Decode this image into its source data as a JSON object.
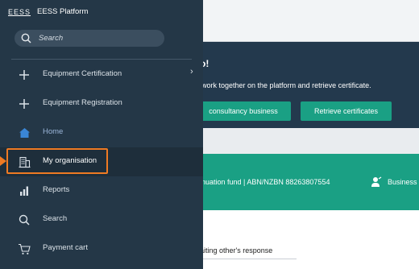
{
  "brand": {
    "logo": "EESS",
    "name": "EESS Platform"
  },
  "search": {
    "placeholder": "Search"
  },
  "sidebar": {
    "items": [
      {
        "label": "Equipment Certification",
        "icon": "plus-icon",
        "has_chevron": true,
        "chevron": "›"
      },
      {
        "label": "Equipment Registration",
        "icon": "plus-icon"
      },
      {
        "label": "Home",
        "icon": "home-icon"
      },
      {
        "label": "My organisation",
        "icon": "building-icon"
      },
      {
        "label": "Reports",
        "icon": "bar-chart-icon"
      },
      {
        "label": "Search",
        "icon": "search-icon"
      },
      {
        "label": "Payment cart",
        "icon": "cart-icon"
      }
    ]
  },
  "background": {
    "hero_title": "o!",
    "hero_desc": "work together on the platform and retrieve certificate.",
    "btn_consultancy": "consultancy business",
    "btn_retrieve": "Retrieve certificates",
    "org_text": "nuation fund  | ABN/NZBN 88263807554",
    "org_business": "Business",
    "awaiting": "aiting other's response"
  },
  "colors": {
    "sidebar_bg": "#243747",
    "selected_bg": "#1e2e3b",
    "highlight": "#ef7a23",
    "accent_green": "#1aa084",
    "hero_bg": "#23394d",
    "home_icon": "#3a86d6"
  }
}
